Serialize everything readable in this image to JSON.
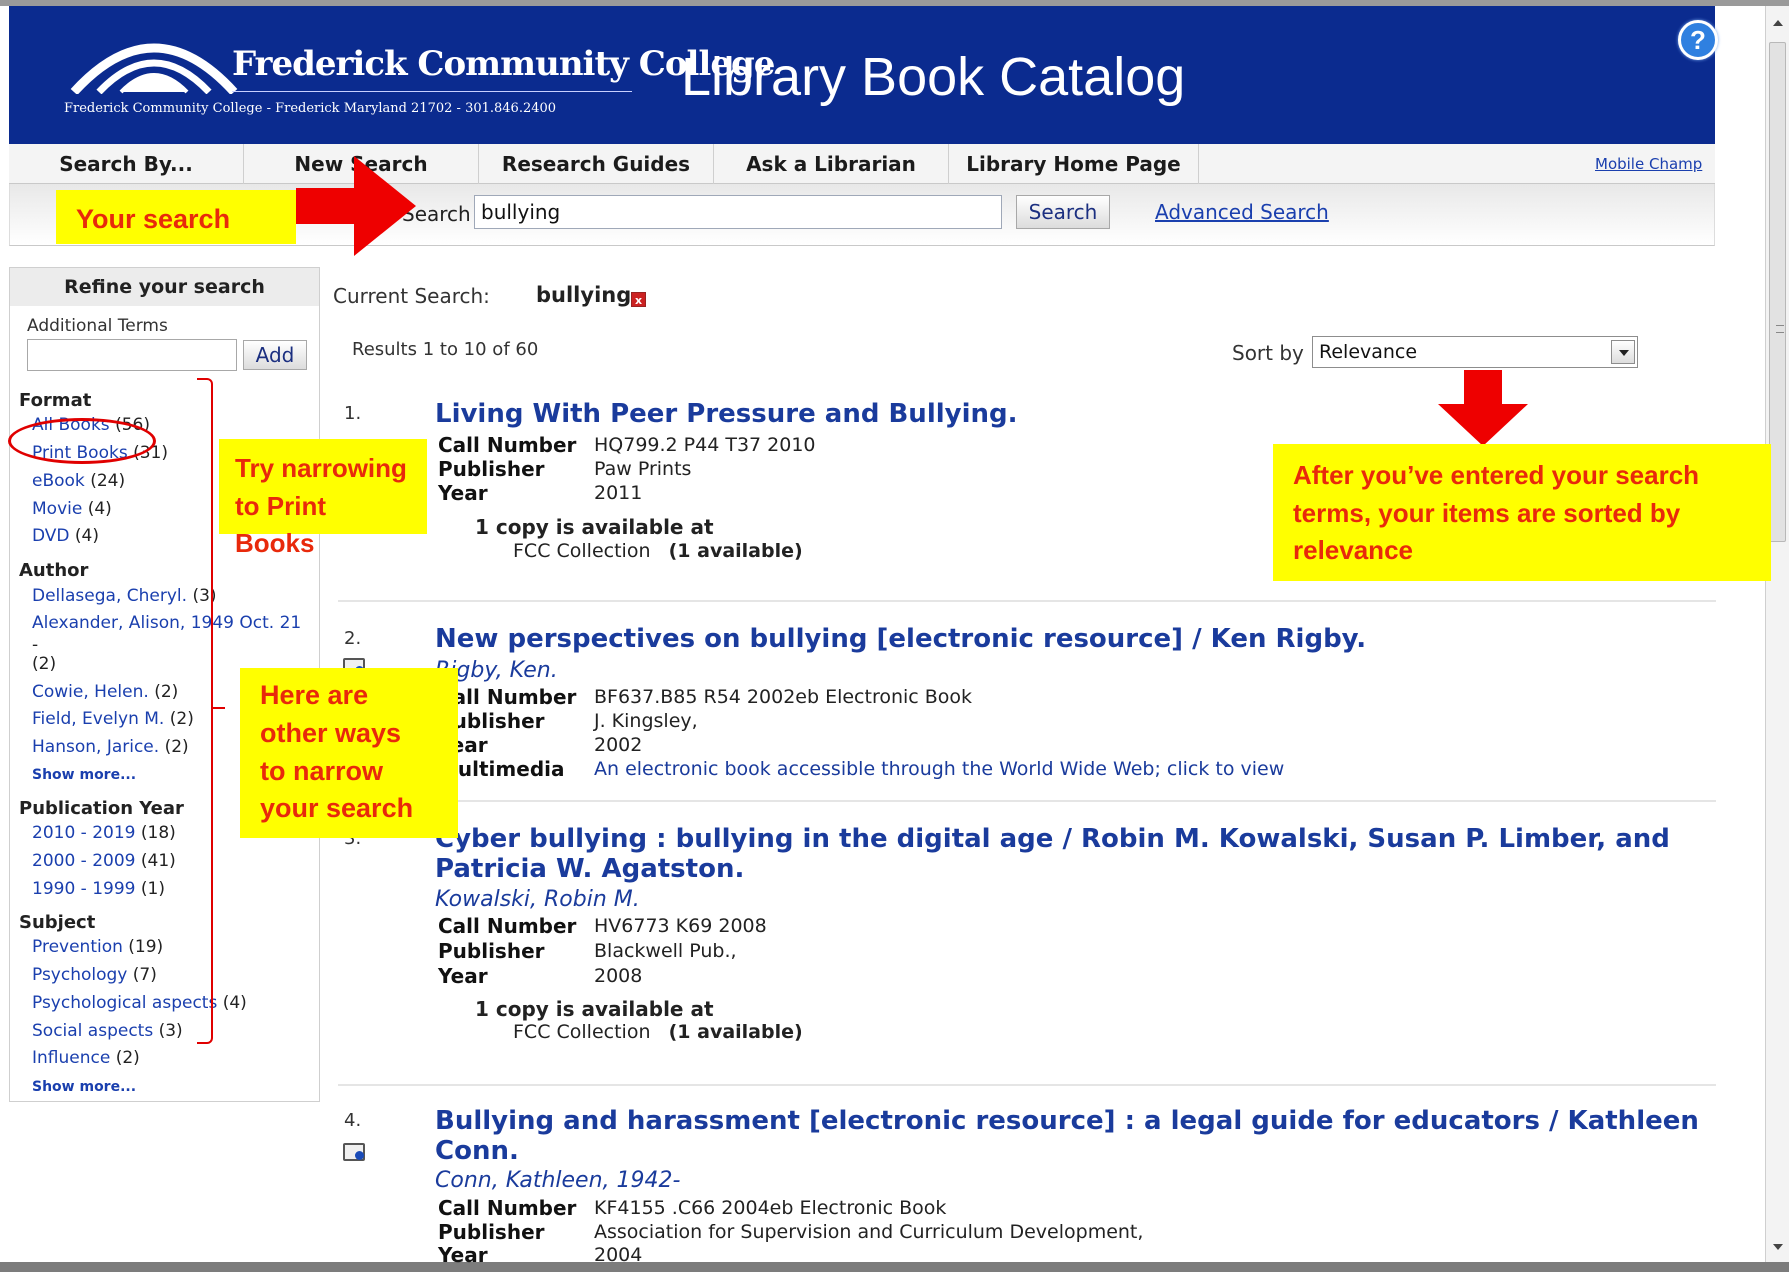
{
  "header": {
    "college_name": "Frederick Community College",
    "college_address": "Frederick Community College - Frederick Maryland 21702 - 301.846.2400",
    "catalog_title": "Library Book Catalog",
    "help_glyph": "?"
  },
  "nav": {
    "items": [
      {
        "label": "Search By..."
      },
      {
        "label": "New Search"
      },
      {
        "label": "Research Guides"
      },
      {
        "label": "Ask a Librarian"
      },
      {
        "label": "Library Home Page"
      }
    ],
    "mobile_label": "Mobile Champ"
  },
  "search": {
    "label": "Search",
    "value": "bullying",
    "button_label": "Search",
    "advanced_label": "Advanced Search"
  },
  "annotations": {
    "your_search": "Your search",
    "print_books_tip": [
      "Try narrowing",
      "to Print Books"
    ],
    "other_ways_tip": [
      "Here are",
      "other ways",
      "to narrow",
      "your search"
    ],
    "sort_tip": [
      "After you’ve entered your search",
      "terms, your items are sorted by",
      "relevance"
    ]
  },
  "sidebar": {
    "title": "Refine your search",
    "additional_terms_label": "Additional Terms",
    "add_button_label": "Add",
    "format": {
      "heading": "Format",
      "items": [
        {
          "label": "All Books",
          "count": "(56)"
        },
        {
          "label": "Print Books",
          "count": "(31)"
        },
        {
          "label": "eBook",
          "count": "(24)"
        },
        {
          "label": "Movie",
          "count": "(4)"
        },
        {
          "label": "DVD",
          "count": "(4)"
        }
      ]
    },
    "author": {
      "heading": "Author",
      "items": [
        {
          "label": "Dellasega, Cheryl.",
          "count": "(3)"
        },
        {
          "label": "Alexander, Alison, 1949 Oct. 21",
          "count": "-"
        },
        {
          "label": "",
          "count": "(2)"
        },
        {
          "label": "Cowie, Helen.",
          "count": "(2)"
        },
        {
          "label": "Field, Evelyn M.",
          "count": "(2)"
        },
        {
          "label": "Hanson, Jarice.",
          "count": "(2)"
        }
      ],
      "show_more": "Show more..."
    },
    "pub_year": {
      "heading": "Publication Year",
      "items": [
        {
          "label": "2010 - 2019",
          "count": "(18)"
        },
        {
          "label": "2000 - 2009",
          "count": "(41)"
        },
        {
          "label": "1990 - 1999",
          "count": "(1)"
        }
      ]
    },
    "subject": {
      "heading": "Subject",
      "items": [
        {
          "label": "Prevention",
          "count": "(19)"
        },
        {
          "label": "Psychology",
          "count": "(7)"
        },
        {
          "label": "Psychological aspects",
          "count": "(4)"
        },
        {
          "label": "Social aspects",
          "count": "(3)"
        },
        {
          "label": "Influence",
          "count": "(2)"
        }
      ],
      "show_more": "Show more..."
    }
  },
  "results": {
    "current_search_label": "Current Search:",
    "current_search_term": "bullying",
    "remove_glyph": "x",
    "count_text": "Results 1 to 10 of 60",
    "sort_label": "Sort by",
    "sort_value": "Relevance",
    "items": [
      {
        "num": "1.",
        "title": "Living With Peer Pressure and Bullying.",
        "fields": [
          {
            "label": "Call Number",
            "value": "HQ799.2 P44 T37 2010"
          },
          {
            "label": "Publisher",
            "value": "Paw Prints"
          },
          {
            "label": "Year",
            "value": "2011"
          }
        ],
        "availability": "1 copy is available at",
        "collection": "FCC Collection",
        "available_count": "(1 available)"
      },
      {
        "num": "2.",
        "title": "New perspectives on bullying [electronic resource] / Ken Rigby.",
        "author": "Rigby, Ken.",
        "fields": [
          {
            "label": "Call Number",
            "value": "BF637.B85 R54 2002eb Electronic Book"
          },
          {
            "label": "Publisher",
            "value": "J. Kingsley,"
          },
          {
            "label": "Year",
            "value": "2002"
          },
          {
            "label": "Multimedia",
            "value": "An electronic book accessible through the World Wide Web; click to view"
          }
        ]
      },
      {
        "num": "3.",
        "title": "Cyber bullying : bullying in the digital age / Robin M. Kowalski, Susan P. Limber, and Patricia W. Agatston.",
        "author": "Kowalski, Robin M.",
        "fields": [
          {
            "label": "Call Number",
            "value": "HV6773 K69 2008"
          },
          {
            "label": "Publisher",
            "value": "Blackwell Pub.,"
          },
          {
            "label": "Year",
            "value": "2008"
          }
        ],
        "availability": "1 copy is available at",
        "collection": "FCC Collection",
        "available_count": "(1 available)"
      },
      {
        "num": "4.",
        "title": "Bullying and harassment [electronic resource] : a legal guide for educators / Kathleen Conn.",
        "author": "Conn, Kathleen, 1942-",
        "fields": [
          {
            "label": "Call Number",
            "value": "KF4155 .C66 2004eb Electronic Book"
          },
          {
            "label": "Publisher",
            "value": "Association for Supervision and Curriculum Development,"
          },
          {
            "label": "Year",
            "value": "2004"
          }
        ]
      }
    ]
  },
  "colors": {
    "header_blue": "#0b2b8f",
    "link_blue": "#1a3b9c",
    "callout_yellow": "#ffff00",
    "callout_text_red": "#e8290b",
    "annotation_red": "#e00000"
  }
}
